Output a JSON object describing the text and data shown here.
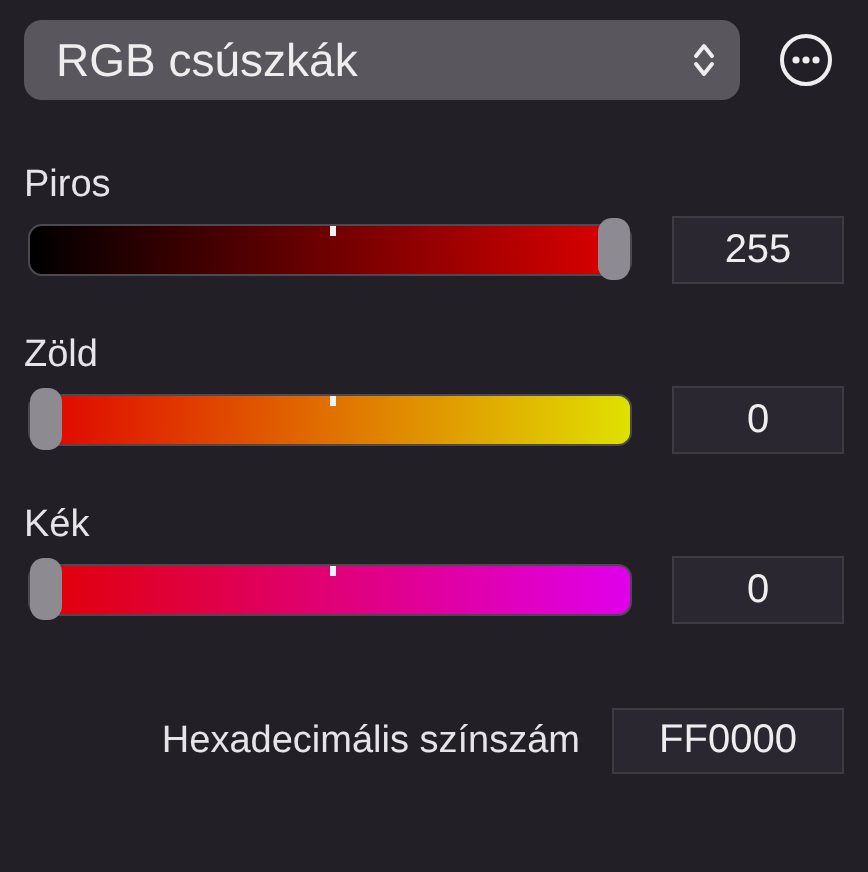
{
  "picker": {
    "label": "RGB csúszkák"
  },
  "channels": [
    {
      "name": "Piros",
      "level": 1,
      "value": "255"
    },
    {
      "name": "Zöld",
      "level": 0,
      "value": "0"
    },
    {
      "name": "Kék",
      "level": 0,
      "value": "0"
    }
  ],
  "hex": {
    "label": "Hexadecimális színszám",
    "value": "FF0000"
  }
}
